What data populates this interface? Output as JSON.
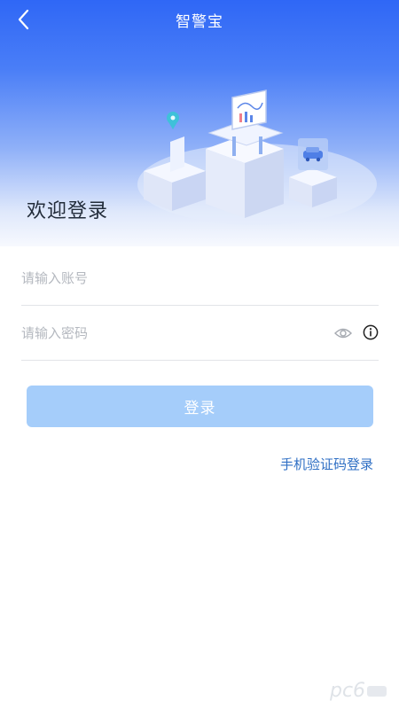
{
  "nav": {
    "title": "智警宝",
    "back_icon": "chevron-left-icon"
  },
  "hero": {
    "welcome_text": "欢迎登录",
    "illustration_icon": "isometric-office-illustration"
  },
  "form": {
    "account": {
      "placeholder": "请输入账号",
      "value": ""
    },
    "password": {
      "placeholder": "请输入密码",
      "value": ""
    },
    "eye_icon": "eye-icon",
    "info_icon": "info-circle-icon"
  },
  "actions": {
    "login_label": "登录",
    "sms_login_label": "手机验证码登录"
  },
  "colors": {
    "header_blue": "#2f67f6",
    "login_button": "#a5cdfa",
    "link_blue": "#2f6fc4"
  }
}
